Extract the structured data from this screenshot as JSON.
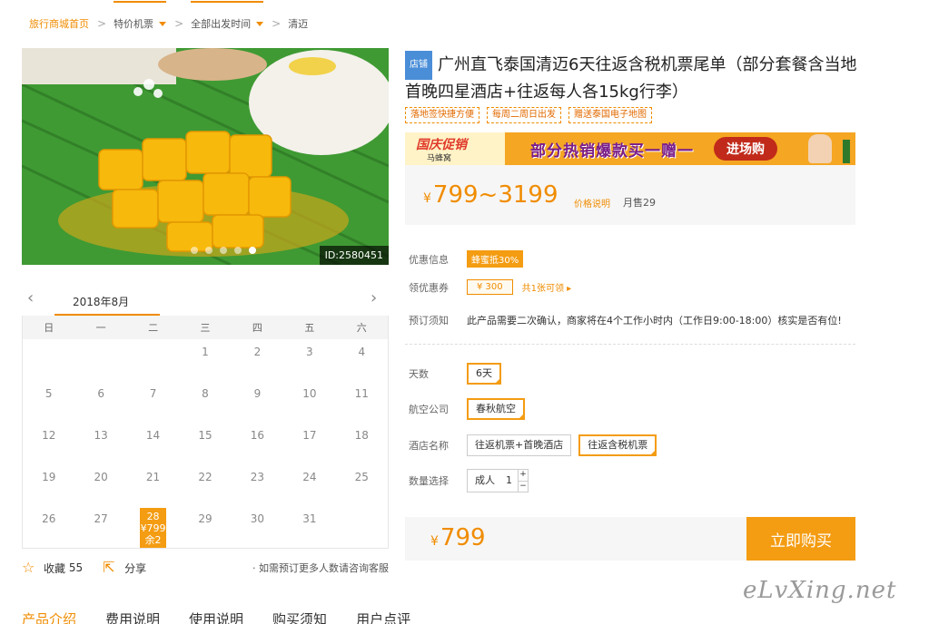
{
  "breadcrumb": {
    "home": "旅行商城首页",
    "sep": ">",
    "items": [
      {
        "label": "特价机票",
        "dropdown": true
      },
      {
        "label": "全部出发时间",
        "dropdown": true
      },
      {
        "label": "清迈",
        "dropdown": false
      }
    ]
  },
  "hero": {
    "id_tag": "ID:2580451",
    "slide_count": 5,
    "active_slide": 5
  },
  "calendar": {
    "month": "2018年8月",
    "prev_icon": "chevron-left-icon",
    "next_icon": "chevron-right-icon",
    "weekdays": [
      "日",
      "一",
      "二",
      "三",
      "四",
      "五",
      "六"
    ],
    "weeks": [
      [
        "",
        "",
        "",
        "1",
        "2",
        "3",
        "4"
      ],
      [
        "5",
        "6",
        "7",
        "8",
        "9",
        "10",
        "11"
      ],
      [
        "12",
        "13",
        "14",
        "15",
        "16",
        "17",
        "18"
      ],
      [
        "19",
        "20",
        "21",
        "22",
        "23",
        "24",
        "25"
      ],
      [
        "26",
        "27",
        "28",
        "29",
        "30",
        "31",
        ""
      ]
    ],
    "active_day": {
      "day": "28",
      "price": "¥799",
      "stock": "余2"
    }
  },
  "actions": {
    "favorite_label": "收藏",
    "favorite_count": "55",
    "share_label": "分享",
    "tip": "· 如需预订更多人数请咨询客服"
  },
  "product": {
    "shop_tag": "店铺",
    "title": "广州直飞泰国清迈6天往返含税机票尾单（部分套餐含当地首晚四星酒店+往返每人各15kg行李）",
    "features": [
      "落地签快捷方便",
      "每周二周日出发",
      "赠送泰国电子地图"
    ]
  },
  "banner": {
    "logo": "国庆促销",
    "sub": "马蜂窝",
    "main": "部分热销爆款买一赠一",
    "go": "进场购"
  },
  "price": {
    "yen": "¥",
    "range": "799~3199",
    "note": "价格说明",
    "sold": "月售29"
  },
  "info": {
    "promo_label": "优惠信息",
    "promo_badge": "蜂蜜抵30%",
    "coupon_label": "领优惠券",
    "coupon_value": "¥ 300",
    "coupon_more": "共1张可领 ▸",
    "notice_label": "预订须知",
    "notice_text": "此产品需要二次确认，商家将在4个工作小时内（工作日9:00-18:00）核实是否有位!"
  },
  "options": {
    "days_label": "天数",
    "days": [
      "6天"
    ],
    "airline_label": "航空公司",
    "airlines": [
      "春秋航空"
    ],
    "hotel_label": "酒店名称",
    "hotels": [
      {
        "label": "往返机票+首晚酒店",
        "selected": false
      },
      {
        "label": "往返含税机票",
        "selected": true
      }
    ],
    "qty_label": "数量选择",
    "qty_who": "成人",
    "qty_value": "1",
    "plus": "+",
    "minus": "−"
  },
  "buy": {
    "yen": "¥",
    "price": "799",
    "button": "立即购买"
  },
  "tabs": [
    "产品介绍",
    "费用说明",
    "使用说明",
    "购买须知",
    "用户点评"
  ],
  "watermark": "eLvXing.net",
  "colors": {
    "accent": "#f49c12",
    "accent_text": "#f08c00",
    "shop_tag": "#4a8ed8"
  }
}
